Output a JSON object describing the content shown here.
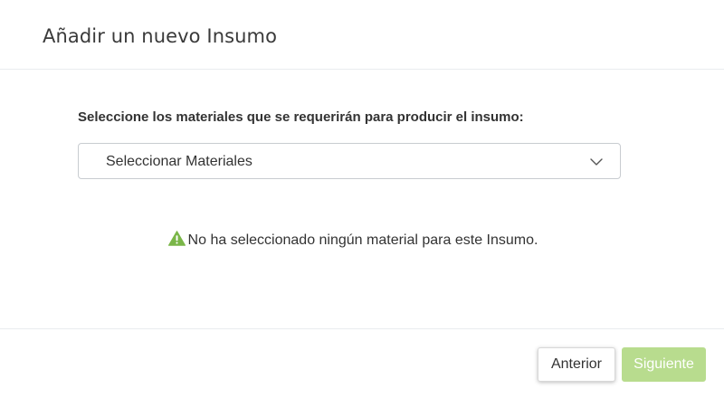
{
  "modal": {
    "title": "Añadir un nuevo Insumo"
  },
  "body": {
    "prompt_label": "Seleccione los materiales que se requerirán para producir el insumo:",
    "select": {
      "value": "Seleccionar Materiales",
      "icon": "chevron-down-icon"
    },
    "empty_state": {
      "icon": "warning-triangle-icon",
      "message": "No ha seleccionado ningún material para este Insumo."
    }
  },
  "footer": {
    "prev_label": "Anterior",
    "next_label": "Siguiente"
  },
  "colors": {
    "warning_icon": "#7ab648",
    "next_button_disabled": "#b8dc8e",
    "divider": "#e9ecef"
  }
}
